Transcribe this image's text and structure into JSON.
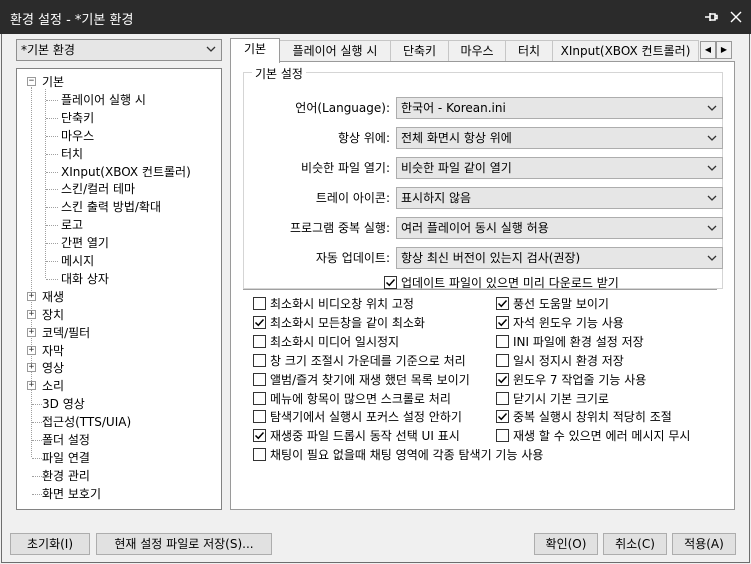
{
  "window": {
    "title": "환경 설정 - *기본 환경"
  },
  "preset": {
    "selected": "*기본 환경"
  },
  "tree": {
    "root": {
      "label": "기본"
    },
    "root_children": [
      "플레이어 실행 시",
      "단축키",
      "마우스",
      "터치",
      "XInput(XBOX 컨트롤러)",
      "스킨/컬러 테마",
      "스킨 출력 방법/확대",
      "로고",
      "간편 열기",
      "메시지",
      "대화 상자"
    ],
    "groups": [
      "재생",
      "장치",
      "코덱/필터",
      "자막",
      "영상",
      "소리"
    ],
    "leaves": [
      "3D 영상",
      "접근성(TTS/UIA)",
      "폴더 설정",
      "파일 연결",
      "환경 관리",
      "화면 보호기"
    ]
  },
  "tabs": [
    "기본",
    "플레이어 실행 시",
    "단축키",
    "마우스",
    "터치",
    "XInput(XBOX 컨트롤러)"
  ],
  "group_title": "기본 설정",
  "fields": [
    {
      "label": "언어(Language):",
      "value": "한국어 - Korean.ini"
    },
    {
      "label": "항상 위에:",
      "value": "전체 화면시 항상 위에"
    },
    {
      "label": "비슷한 파일 열기:",
      "value": "비슷한 파일 같이 열기"
    },
    {
      "label": "트레이 아이콘:",
      "value": "표시하지 않음"
    },
    {
      "label": "프로그램 중복 실행:",
      "value": "여러 플레이어 동시 실행 허용"
    },
    {
      "label": "자동 업데이트:",
      "value": "항상 최신 버전이 있는지 검사(권장)"
    }
  ],
  "update_download": {
    "label": "업데이트 파일이 있으면 미리 다운로드 받기",
    "checked": true
  },
  "checkboxes_left": [
    {
      "label": "최소화시 비디오창 위치 고정",
      "checked": false
    },
    {
      "label": "최소화시 모든창을 같이 최소화",
      "checked": true
    },
    {
      "label": "최소화시 미디어 일시정지",
      "checked": false
    },
    {
      "label": "창 크기 조절시 가운데를 기준으로 처리",
      "checked": false
    },
    {
      "label": "앨범/즐겨 찾기에 재생 했던 목록 보이기",
      "checked": false
    },
    {
      "label": "메뉴에 항목이 많으면 스크롤로 처리",
      "checked": false
    },
    {
      "label": "탐색기에서 실행시 포커스 설정 안하기",
      "checked": false
    },
    {
      "label": "재생중 파일 드롭시 동작 선택 UI 표시",
      "checked": true
    },
    {
      "label": "채팅이 필요 없을때 채팅 영역에 각종 탐색기 기능 사용",
      "checked": false
    }
  ],
  "checkboxes_right": [
    {
      "label": "풍선 도움말 보이기",
      "checked": true
    },
    {
      "label": "자석 윈도우 기능 사용",
      "checked": true
    },
    {
      "label": "INI 파일에 환경 설정 저장",
      "checked": false
    },
    {
      "label": "일시 정지시 환경 저장",
      "checked": false
    },
    {
      "label": "윈도우 7 작업줄 기능 사용",
      "checked": true
    },
    {
      "label": "닫기시 기본 크기로",
      "checked": false
    },
    {
      "label": "중복 실행시 창위치 적당히 조절",
      "checked": true
    },
    {
      "label": "재생 할 수 있으면 에러 메시지 무시",
      "checked": false
    }
  ],
  "buttons": {
    "reset": "초기화(I)",
    "save_as": "현재 설정 파일로 저장(S)...",
    "ok": "확인(O)",
    "cancel": "취소(C)",
    "apply": "적용(A)"
  }
}
